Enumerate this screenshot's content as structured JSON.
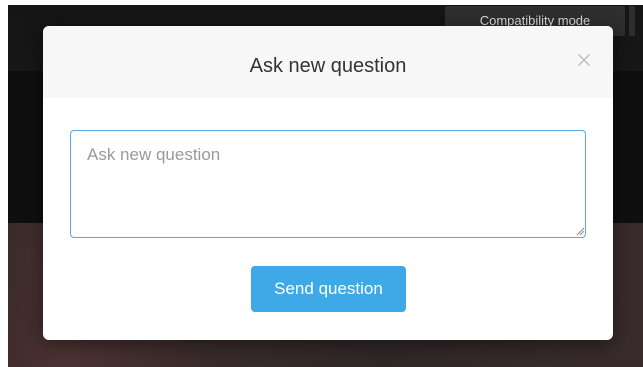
{
  "background": {
    "compatibility_button_label": "Compatibility mode"
  },
  "modal": {
    "title": "Ask new question",
    "close_icon": "close-icon",
    "question_input": {
      "placeholder": "Ask new question",
      "value": ""
    },
    "send_button_label": "Send question"
  },
  "colors": {
    "accent": "#3ea9e6",
    "input_border": "#5aa7e6",
    "header_bg": "#f7f7f7",
    "overlay_dark": "#151515"
  }
}
